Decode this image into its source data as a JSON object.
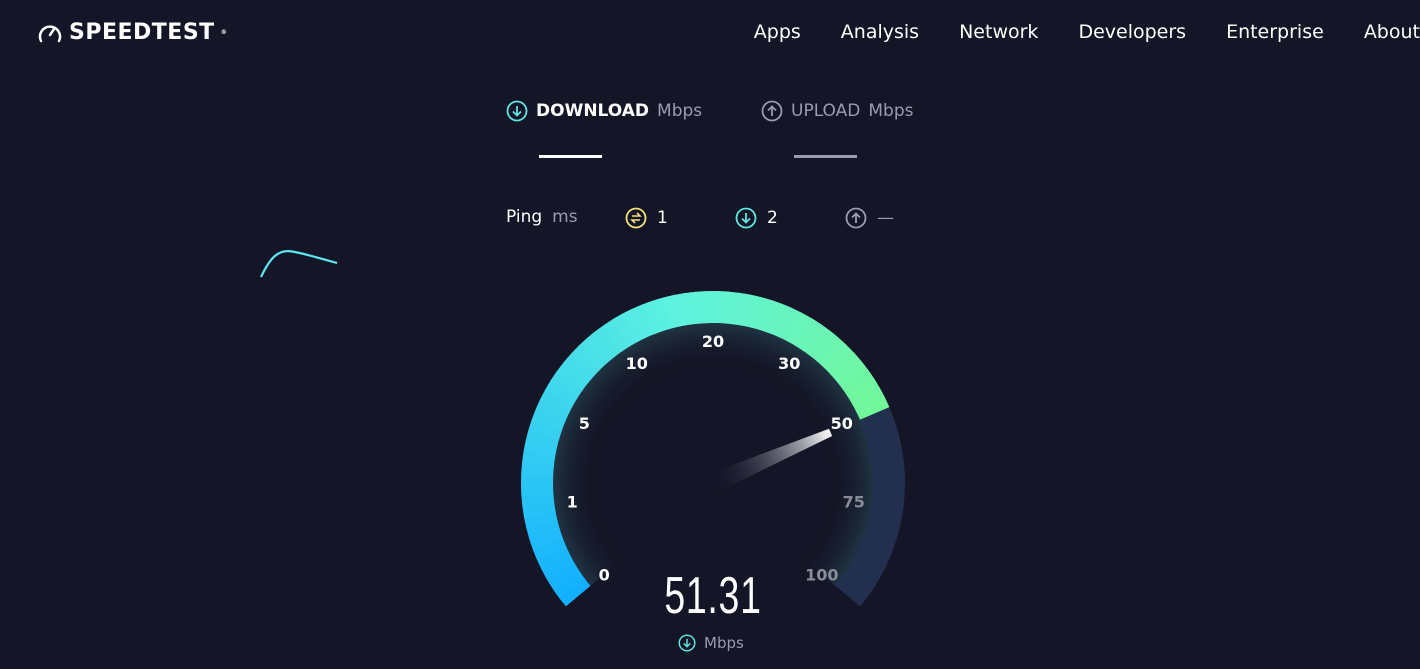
{
  "brand": {
    "name": "SPEEDTEST",
    "mark": "®"
  },
  "nav": {
    "items": [
      "Apps",
      "Analysis",
      "Network",
      "Developers",
      "Enterprise",
      "About"
    ]
  },
  "tabs": {
    "download": {
      "label": "DOWNLOAD",
      "unit": "Mbps",
      "active": true
    },
    "upload": {
      "label": "UPLOAD",
      "unit": "Mbps",
      "active": false
    }
  },
  "ping": {
    "label": "Ping",
    "unit": "ms",
    "idle": "1",
    "download": "2",
    "upload": "—"
  },
  "gauge": {
    "ticks": [
      "0",
      "1",
      "5",
      "10",
      "20",
      "30",
      "50",
      "75",
      "100"
    ],
    "value": 51.31,
    "value_text": "51.31",
    "unit": "Mbps",
    "colors": {
      "start": "#13b0ff",
      "mid": "#5ef2e0",
      "end": "#72f79a",
      "track": "#232f4f",
      "bg": "#141526"
    }
  }
}
